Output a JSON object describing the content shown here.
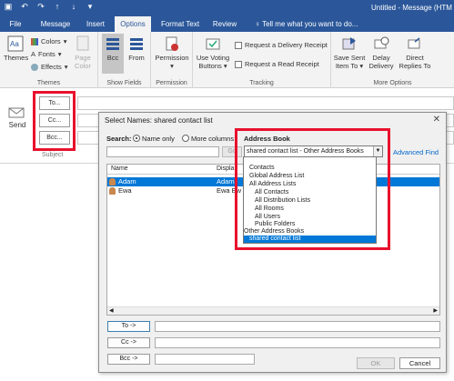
{
  "window": {
    "title": "Untitled - Message (HTM",
    "qat": [
      "save-icon",
      "undo-icon",
      "redo-icon",
      "up-icon",
      "down-icon",
      "more-icon"
    ]
  },
  "tabs": [
    {
      "label": "File"
    },
    {
      "label": "Message"
    },
    {
      "label": "Insert"
    },
    {
      "label": "Options"
    },
    {
      "label": "Format Text"
    },
    {
      "label": "Review"
    }
  ],
  "tell_me": "♀ Tell me what you want to do...",
  "ribbon": {
    "themes": {
      "label": "Themes",
      "colors": "Colors",
      "fonts": "Fonts",
      "effects": "Effects",
      "page_color": "Page",
      "page_color2": "Color",
      "group": "Themes"
    },
    "show_fields": {
      "bcc": "Bcc",
      "from": "From",
      "group": "Show Fields"
    },
    "permission": {
      "label": "Permission",
      "group": "Permission"
    },
    "tracking": {
      "voting": "Use Voting",
      "voting2": "Buttons",
      "delivery": "Request a Delivery Receipt",
      "read": "Request a Read Receipt",
      "group": "Tracking"
    },
    "more_options": {
      "save_sent": "Save Sent",
      "save_sent2": "Item To",
      "delay": "Delay",
      "delay2": "Delivery",
      "direct": "Direct",
      "direct2": "Replies To",
      "group": "More Options"
    }
  },
  "compose": {
    "send": "Send",
    "to": "To...",
    "cc": "Cc...",
    "bcc": "Bcc...",
    "subject": "Subject"
  },
  "dialog": {
    "title": "Select Names: shared contact list",
    "search_label": "Search:",
    "name_only": "Name only",
    "more_columns": "More columns",
    "address_book_label": "Address Book",
    "address_book_value": "shared contact list - Other Address Books",
    "go": "Go",
    "advanced_find": "Advanced Find",
    "col_name": "Name",
    "col_display": "Displa",
    "contacts": [
      {
        "name": "Adam",
        "display": "Adam",
        "selected": true
      },
      {
        "name": "Ewa",
        "display": "Ewa Ew",
        "selected": false
      }
    ],
    "dropdown": [
      {
        "label": "Contacts",
        "indent": 1
      },
      {
        "label": "Global Address List",
        "indent": 1
      },
      {
        "label": "All Address Lists",
        "indent": 1
      },
      {
        "label": "All Contacts",
        "indent": 2
      },
      {
        "label": "All Distribution Lists",
        "indent": 2
      },
      {
        "label": "All Rooms",
        "indent": 2
      },
      {
        "label": "All Users",
        "indent": 2
      },
      {
        "label": "Public Folders",
        "indent": 2
      },
      {
        "label": "Other Address Books",
        "indent": 1
      },
      {
        "label": "shared contact list",
        "indent": 2,
        "selected": true
      }
    ],
    "to_btn": "To ->",
    "cc_btn": "Cc ->",
    "bcc_btn": "Bcc ->",
    "ok": "OK",
    "cancel": "Cancel"
  }
}
